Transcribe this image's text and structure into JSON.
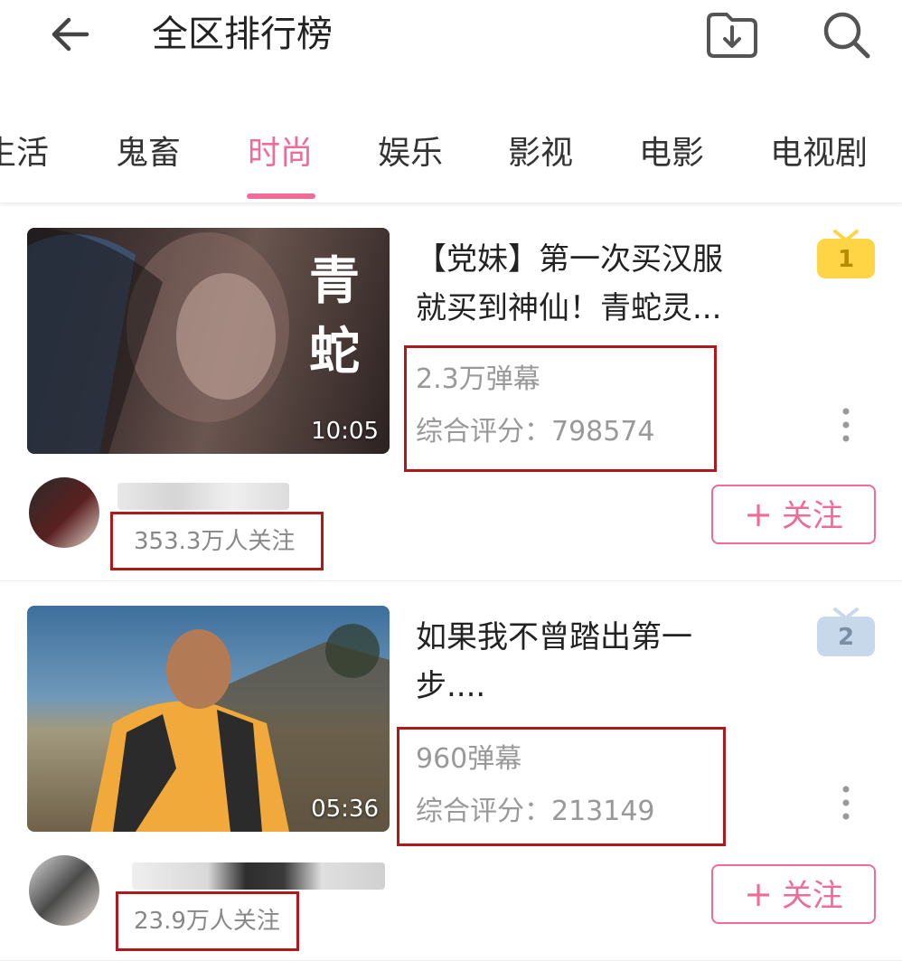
{
  "header": {
    "title": "全区排行榜"
  },
  "tabs": [
    {
      "label": "生活",
      "active": false
    },
    {
      "label": "鬼畜",
      "active": false
    },
    {
      "label": "时尚",
      "active": true
    },
    {
      "label": "娱乐",
      "active": false
    },
    {
      "label": "影视",
      "active": false
    },
    {
      "label": "电影",
      "active": false
    },
    {
      "label": "电视剧",
      "active": false
    }
  ],
  "videos": [
    {
      "rank": "1",
      "title_line1": "【党妹】第一次买汉服",
      "title_line2": "就买到神仙！青蛇灵...",
      "thumb_text": "青蛇",
      "duration": "10:05",
      "danmaku": "2.3万弹幕",
      "score": "综合评分：798574",
      "followers": "353.3万人关注",
      "follow_label": "关注"
    },
    {
      "rank": "2",
      "title_line1": "如果我不曾踏出第一",
      "title_line2": "步....",
      "duration": "05:36",
      "danmaku": "960弹幕",
      "score": "综合评分：213149",
      "followers": "23.9万人关注",
      "follow_label": "关注"
    }
  ],
  "colors": {
    "accent": "#ee6c96",
    "rank1": "#ffd545",
    "rank2": "#c6d8ea",
    "highlight_box": "#b0191a"
  }
}
